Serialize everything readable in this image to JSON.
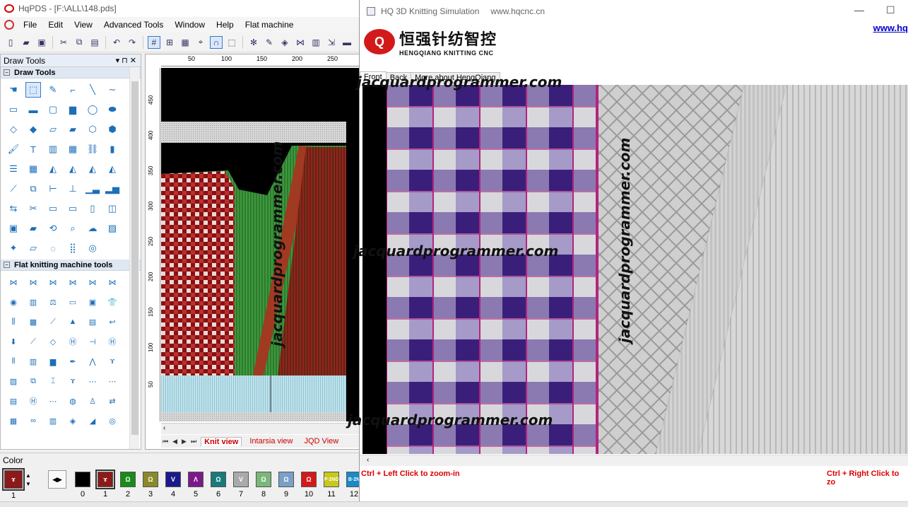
{
  "app": {
    "title": "HqPDS - [F:\\ALL\\148.pds]",
    "menu": [
      "File",
      "Edit",
      "View",
      "Advanced Tools",
      "Window",
      "Help",
      "Flat machine"
    ]
  },
  "draw_panel": {
    "title": "Draw Tools",
    "pin": "▾  ⊓  ✕",
    "section_draw": "Draw Tools",
    "section_flat": "Flat knitting machine tools"
  },
  "ruler": {
    "top": [
      "50",
      "100",
      "150",
      "200",
      "250"
    ],
    "left": [
      "450",
      "400",
      "350",
      "300",
      "250",
      "200",
      "150",
      "100",
      "50"
    ]
  },
  "view_tabs": [
    "Knit view",
    "Intarsia view",
    "JQD View"
  ],
  "colorbar": {
    "title": "Color",
    "left_number": "1",
    "swatches": [
      {
        "num": "0",
        "color": "#000000",
        "glyph": ""
      },
      {
        "num": "1",
        "color": "#8b1a1a",
        "glyph": "ɤ"
      },
      {
        "num": "2",
        "color": "#1a8a1a",
        "glyph": "Ω"
      },
      {
        "num": "3",
        "color": "#8a8a2a",
        "glyph": "Ω"
      },
      {
        "num": "4",
        "color": "#1a1a8a",
        "glyph": "V"
      },
      {
        "num": "5",
        "color": "#7a1a8a",
        "glyph": "Λ"
      },
      {
        "num": "6",
        "color": "#1a7a7a",
        "glyph": "Ω"
      },
      {
        "num": "7",
        "color": "#aaaaaa",
        "glyph": "V"
      },
      {
        "num": "8",
        "color": "#7ab87a",
        "glyph": "Ω"
      },
      {
        "num": "9",
        "color": "#7aa0c8",
        "glyph": "Ω"
      },
      {
        "num": "10",
        "color": "#d21a1a",
        "glyph": "Ω"
      },
      {
        "num": "11",
        "color": "#c8c81a",
        "glyph": "P·2ND"
      },
      {
        "num": "12",
        "color": "#1a8ac8",
        "glyph": "B·2N"
      }
    ]
  },
  "sim": {
    "title": "HQ 3D Knitting Simulation",
    "site": "www.hqcnc.cn",
    "link": "www.hq",
    "logo_cn": "恒强针纺智控",
    "logo_en": "HENGQIANG KNITTING CNC",
    "tabs": [
      "Front",
      "Back",
      "More about HengQiang"
    ],
    "hint_left": "Ctrl + Left Click to zoom-in",
    "hint_right": "Ctrl + Right Click to zo",
    "controls": {
      "minimize": "—",
      "maximize": "☐"
    }
  },
  "watermarks": {
    "text": "jacquardprogrammer.com"
  },
  "colors": {
    "fabric_purple": "#4b2d8e",
    "fabric_magenta": "#b3247f",
    "fabric_grey": "#d4d4d4",
    "design_red": "#8b1010",
    "design_green": "#2f7a2f"
  }
}
